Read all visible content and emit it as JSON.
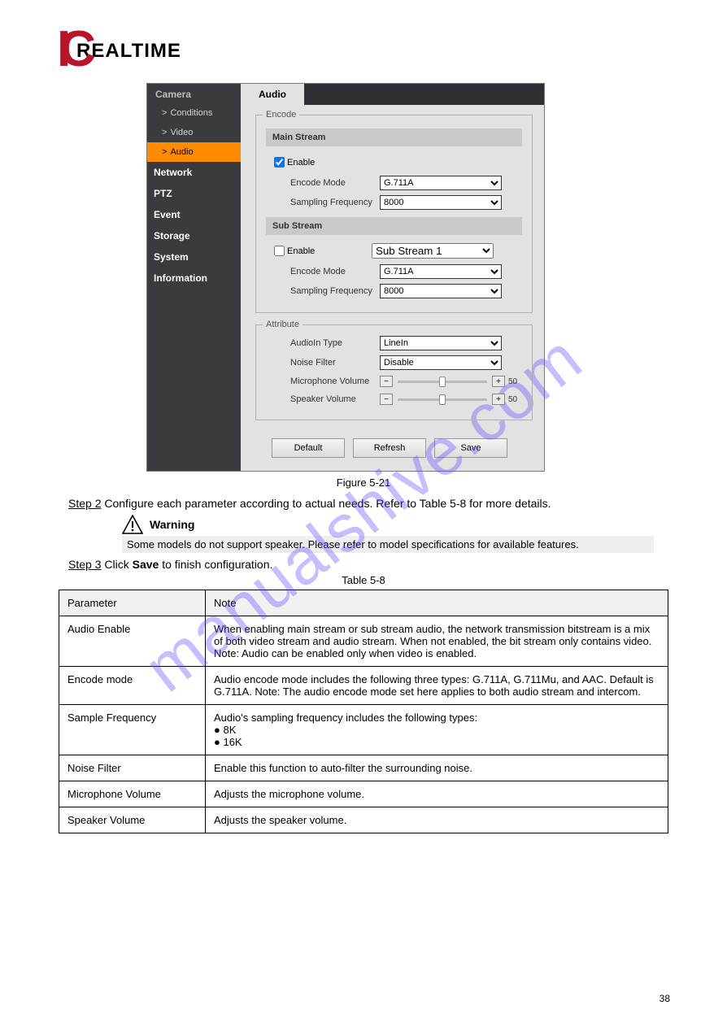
{
  "logo": {
    "ic": "IC",
    "text": "REALTIME"
  },
  "watermark": "manualshive.com",
  "figure_caption": "Figure 5-21",
  "screenshot": {
    "sidebar": {
      "group_camera": "Camera",
      "items": [
        {
          "label": "Conditions",
          "chev": ">"
        },
        {
          "label": "Video",
          "chev": ">"
        },
        {
          "label": "Audio",
          "chev": ">",
          "active": true
        }
      ],
      "tops": [
        "Network",
        "PTZ",
        "Event",
        "Storage",
        "System",
        "Information"
      ]
    },
    "tab_audio": "Audio",
    "encode": {
      "legend": "Encode",
      "main_stream_head": "Main Stream",
      "main_enable": "Enable",
      "main_enable_checked": true,
      "encode_mode_label": "Encode Mode",
      "encode_mode_value": "G.711A",
      "sampling_label": "Sampling Frequency",
      "sampling_value": "8000",
      "sub_stream_head": "Sub Stream",
      "sub_enable": "Enable",
      "sub_enable_checked": false,
      "sub_select_value": "Sub Stream 1"
    },
    "attribute": {
      "legend": "Attribute",
      "audioin_label": "AudioIn Type",
      "audioin_value": "LineIn",
      "noise_label": "Noise Filter",
      "noise_value": "Disable",
      "mic_label": "Microphone Volume",
      "mic_value": "50",
      "spk_label": "Speaker Volume",
      "spk_value": "50"
    },
    "buttons": {
      "default": "Default",
      "refresh": "Refresh",
      "save": "Save"
    }
  },
  "step2_prefix": "Step 2",
  "step2_body": "Configure each parameter according to actual needs. Refer to Table 5-8 for more details.",
  "warning_label": "Warning",
  "warning_bar": "Some models do not support speaker. Please refer to model specifications for available features.",
  "step3_prefix": "Step 3",
  "step3_body_a": "Click ",
  "step3_body_save": "Save",
  "step3_body_b": " to finish configuration.",
  "table_caption": "Table 5-8",
  "table": {
    "head_param": "Parameter",
    "head_note": "Note",
    "rows": [
      {
        "param": "Audio Enable",
        "note": "When enabling main stream or sub stream audio, the network transmission bitstream is a mix of both video stream and audio stream. When not enabled, the bit stream only contains video. Note: Audio can be enabled only when video is enabled."
      },
      {
        "param": "Encode mode",
        "note": "Audio encode mode includes the following three types: G.711A, G.711Mu, and AAC. Default is G.711A. Note: The audio encode mode set here applies to both audio stream and intercom."
      },
      {
        "param": "Sample Frequency",
        "note": "Audio's sampling frequency includes the following types:\n● 8K\n● 16K"
      },
      {
        "param": "Noise Filter",
        "note": "Enable this function to auto-filter the surrounding noise."
      },
      {
        "param": "Microphone Volume",
        "note": "Adjusts the microphone volume."
      },
      {
        "param": "Speaker Volume",
        "note": "Adjusts the speaker volume."
      }
    ]
  },
  "pagenum": "38"
}
